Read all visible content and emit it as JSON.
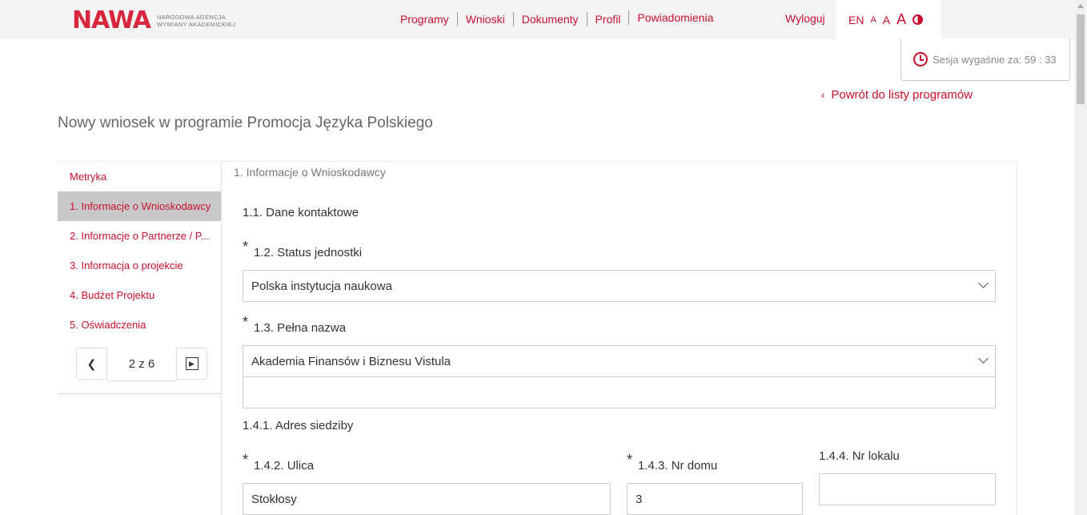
{
  "header": {
    "logo": {
      "mark": "NAWA",
      "line1": "NARODOWA AGENCJA",
      "line2": "WYMIANY AKADEMICKIEJ"
    },
    "nav": [
      "Programy",
      "Wnioski",
      "Dokumenty",
      "Profil",
      "Powiadomienia"
    ],
    "logout": "Wyloguj",
    "access": {
      "lang": "EN",
      "font_small": "A",
      "font_medium": "A",
      "font_large": "A"
    }
  },
  "session": {
    "text": "Sesja wygaśnie za: 59 : 33"
  },
  "back_link": "Powrót do listy programów",
  "page_title": "Nowy wniosek w programie Promocja Języka Polskiego",
  "sidebar": {
    "items": [
      {
        "label": "Metryka",
        "active": false
      },
      {
        "label": "1. Informacje o Wnioskodawcy",
        "active": true
      },
      {
        "label": "2. Informacje o Partnerze / P...",
        "active": false
      },
      {
        "label": "3. Informacja o projekcie",
        "active": false
      },
      {
        "label": "4. Budżet Projektu",
        "active": false
      },
      {
        "label": "5. Oświadczenia",
        "active": false
      }
    ],
    "pager": {
      "text": "2 z 6"
    }
  },
  "form": {
    "section_title": "1. Informacje o Wnioskodawcy",
    "contact_label": "1.1. Dane kontaktowe",
    "status_label": "1.2. Status jednostki",
    "status_value": "Polska instytucja naukowa",
    "fullname_label": "1.3. Pełna nazwa",
    "fullname_value": "Akademia Finansów i Biznesu Vistula",
    "fullname_extra": "",
    "address_label": "1.4.1. Adres siedziby",
    "street_label": "1.4.2. Ulica",
    "street_value": "Stokłosy",
    "house_label": "1.4.3. Nr domu",
    "house_value": "3",
    "apt_label": "1.4.4. Nr lokalu",
    "apt_value": "",
    "required_mark": "*"
  },
  "colors": {
    "accent": "#c8102e",
    "active_bg": "#c8c8c8",
    "topbar_bg": "#f4f4f4"
  }
}
